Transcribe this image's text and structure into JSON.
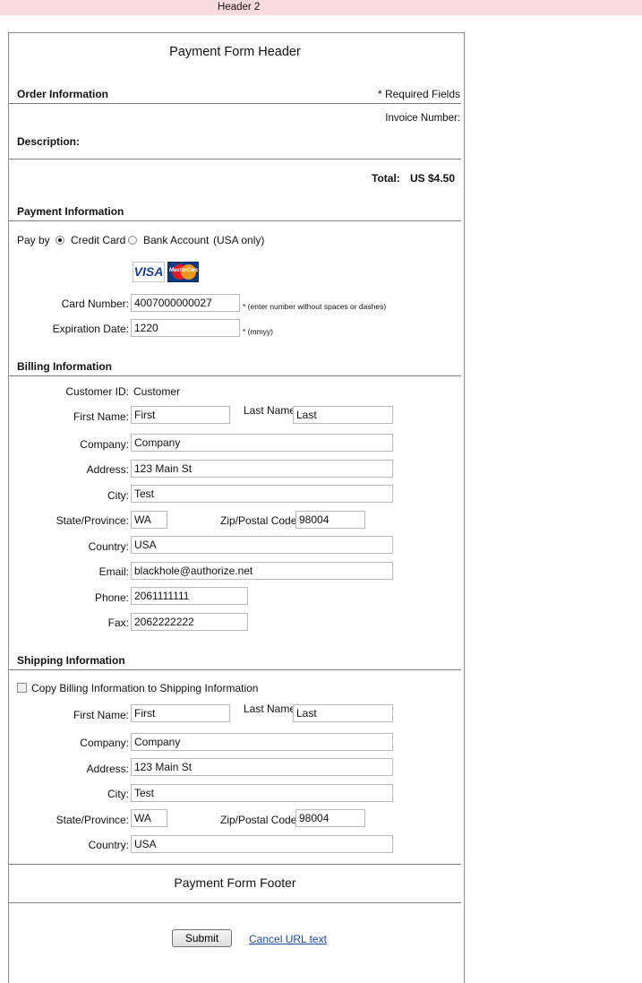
{
  "top_header": "Header 2",
  "form_header": "Payment Form Header",
  "order": {
    "section_title": "Order Information",
    "required_note": "* Required Fields",
    "invoice_label": "Invoice Number:",
    "description_label": "Description:",
    "total_label": "Total:",
    "total_value": "US $4.50"
  },
  "payment": {
    "section_title": "Payment Information",
    "pay_by_label": "Pay by",
    "option_credit": "Credit Card",
    "option_bank": "Bank Account",
    "bank_note": "(USA only)",
    "selected": "Credit Card",
    "card_logos": [
      "VISA",
      "MasterCard"
    ],
    "card_number_label": "Card Number:",
    "card_number_value": "4007000000027",
    "card_number_note": "* (enter number without spaces or dashes)",
    "exp_label": "Expiration Date:",
    "exp_value": "1220",
    "exp_note": "* (mmyy)"
  },
  "billing": {
    "section_title": "Billing Information",
    "customer_id_label": "Customer ID:",
    "customer_id_value": "Customer",
    "first_name_label": "First Name:",
    "first_name_value": "First",
    "last_name_label": "Last Name:",
    "last_name_value": "Last",
    "company_label": "Company:",
    "company_value": "Company",
    "address_label": "Address:",
    "address_value": "123 Main St",
    "city_label": "City:",
    "city_value": "Test",
    "state_label": "State/Province:",
    "state_value": "WA",
    "zip_label": "Zip/Postal Code:",
    "zip_value": "98004",
    "country_label": "Country:",
    "country_value": "USA",
    "email_label": "Email:",
    "email_value": "blackhole@authorize.net",
    "phone_label": "Phone:",
    "phone_value": "2061111111",
    "fax_label": "Fax:",
    "fax_value": "2062222222"
  },
  "shipping": {
    "section_title": "Shipping Information",
    "copy_label": "Copy Billing Information to Shipping Information",
    "first_name_label": "First Name:",
    "first_name_value": "First",
    "last_name_label": "Last Name:",
    "last_name_value": "Last",
    "company_label": "Company:",
    "company_value": "Company",
    "address_label": "Address:",
    "address_value": "123 Main St",
    "city_label": "City:",
    "city_value": "Test",
    "state_label": "State/Province:",
    "state_value": "WA",
    "zip_label": "Zip/Postal Code:",
    "zip_value": "98004",
    "country_label": "Country:",
    "country_value": "USA"
  },
  "form_footer": "Payment Form Footer",
  "actions": {
    "submit_label": "Submit",
    "cancel_label": "Cancel URL text"
  }
}
